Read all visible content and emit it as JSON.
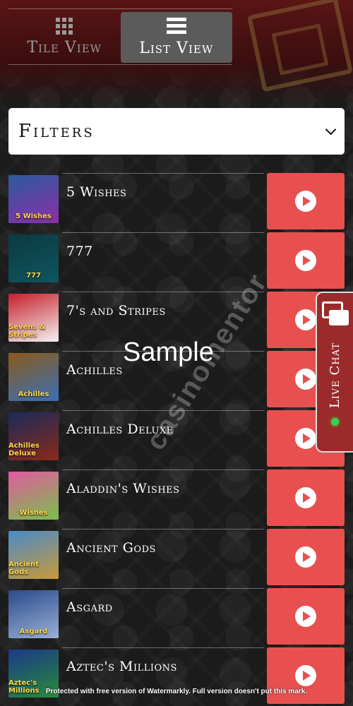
{
  "view_toggle": {
    "tile_label": "Tile View",
    "list_label": "List View",
    "active": "list"
  },
  "filters": {
    "label": "Filters"
  },
  "games": [
    {
      "name": "5 Wishes",
      "thumb_text": "5 Wishes",
      "thumb_colors": [
        "#2c5aa0",
        "#8b2fa8"
      ]
    },
    {
      "name": "777",
      "thumb_text": "777",
      "thumb_colors": [
        "#0b3a40",
        "#0f5560"
      ]
    },
    {
      "name": "7's and Stripes",
      "thumb_text": "Sevens & Stripes",
      "thumb_colors": [
        "#c81e2a",
        "#f2f2f2"
      ]
    },
    {
      "name": "Achilles",
      "thumb_text": "Achilles",
      "thumb_colors": [
        "#8a5a1a",
        "#3a70b8"
      ]
    },
    {
      "name": "Achilles Deluxe",
      "thumb_text": "Achilles Deluxe",
      "thumb_colors": [
        "#1a2a5a",
        "#8a2a1a"
      ]
    },
    {
      "name": "Aladdin's Wishes",
      "thumb_text": "Wishes",
      "thumb_colors": [
        "#e05aa0",
        "#7ac04a"
      ]
    },
    {
      "name": "Ancient Gods",
      "thumb_text": "Ancient Gods",
      "thumb_colors": [
        "#4a8ac8",
        "#c89a3a"
      ]
    },
    {
      "name": "Asgard",
      "thumb_text": "Asgard",
      "thumb_colors": [
        "#2a4a8a",
        "#9ab0d8"
      ]
    },
    {
      "name": "Aztec's Millions",
      "thumb_text": "Aztec's Millions",
      "thumb_colors": [
        "#1a3a8a",
        "#2a8a3a"
      ]
    }
  ],
  "live_chat": {
    "label": "Live Chat",
    "status_color": "#3ccf4e"
  },
  "watermark": {
    "sample": "Sample",
    "brand": "casinomentor",
    "footer": "Protected with free version of Watermarkly. Full version doesn't put this mark."
  },
  "colors": {
    "play_button": "#e85050",
    "active_tab": "#5b5b5b",
    "header_red": "#5a1414"
  }
}
